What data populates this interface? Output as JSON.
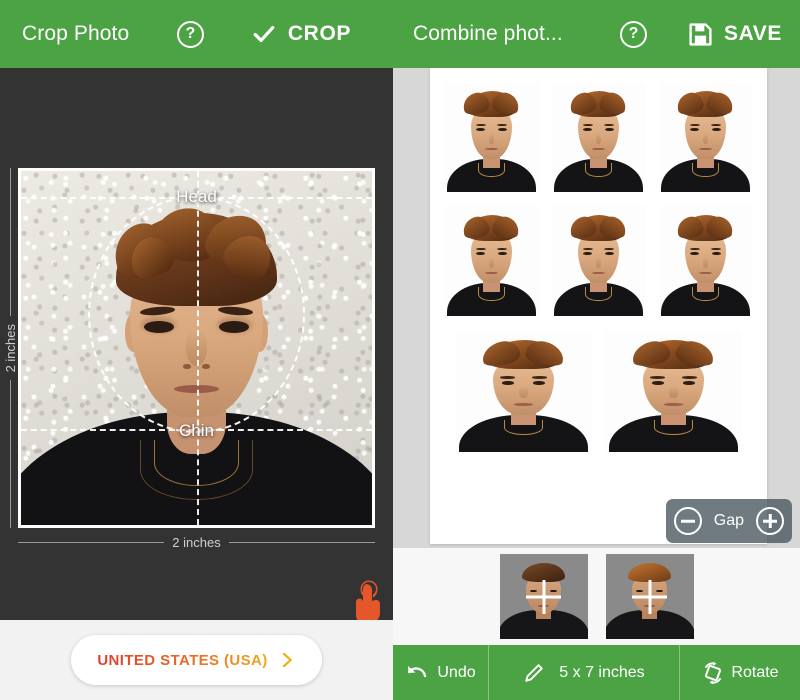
{
  "left_panel": {
    "appbar": {
      "title": "Crop Photo",
      "help_label": "?",
      "help_icon": "help-circle-icon",
      "crop_label": "CROP",
      "check_icon": "check-icon"
    },
    "crop_guides": {
      "head_label": "Head",
      "chin_label": "Chin",
      "width_measure": "2 inches",
      "height_measure": "2 inches",
      "touch_icon": "touch-hand-icon"
    },
    "country_button": {
      "label": "UNITED STATES (USA)",
      "chevron_icon": "chevron-right-icon"
    }
  },
  "right_panel": {
    "appbar": {
      "title": "Combine phot...",
      "help_label": "?",
      "help_icon": "help-circle-icon",
      "save_label": "SAVE",
      "save_icon": "floppy-disk-icon"
    },
    "sheet": {
      "rows": [
        {
          "size": "small",
          "count": 3
        },
        {
          "size": "small",
          "count": 3
        },
        {
          "size": "large",
          "count": 2
        }
      ]
    },
    "gap_control": {
      "label": "Gap",
      "minus_icon": "minus-circle-icon",
      "plus_icon": "plus-circle-icon"
    },
    "thumbnails": [
      {
        "name": "thumbnail-1",
        "overlay_icon": "crosshair-icon"
      },
      {
        "name": "thumbnail-2",
        "overlay_icon": "crosshair-icon"
      }
    ],
    "bottom_toolbar": {
      "undo_label": "Undo",
      "undo_icon": "undo-arrow-icon",
      "edit_icon": "pencil-icon",
      "size_label": "5 x 7 inches",
      "rotate_label": "Rotate",
      "rotate_icon": "rotate-icon"
    }
  },
  "colors": {
    "brand_green": "#4BA344",
    "dark_bg": "#333333",
    "right_bg": "#D7D7D7",
    "accent_orange": "#E8542B",
    "accent_yellow": "#F0A81C",
    "gap_pill": "rgba(70,86,94,0.78)"
  }
}
